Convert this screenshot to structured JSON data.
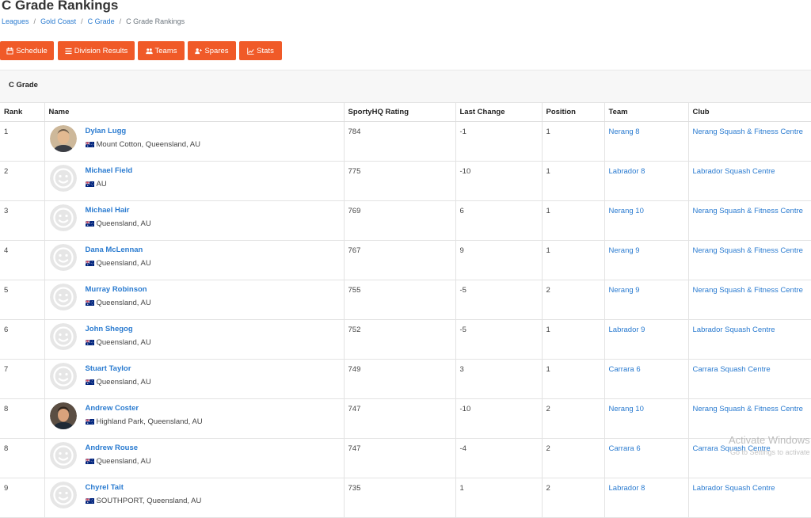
{
  "page": {
    "title": "C Grade Rankings"
  },
  "breadcrumb": {
    "items": [
      {
        "label": "Leagues"
      },
      {
        "label": "Gold Coast"
      },
      {
        "label": "C Grade"
      }
    ],
    "current": "C Grade Rankings",
    "separator": "/"
  },
  "toolbar": {
    "accent_color": "#f05a28",
    "buttons": [
      {
        "label": "Schedule",
        "icon": "calendar-icon"
      },
      {
        "label": "Division Results",
        "icon": "list-icon"
      },
      {
        "label": "Teams",
        "icon": "users-icon"
      },
      {
        "label": "Spares",
        "icon": "user-plus-icon"
      },
      {
        "label": "Stats",
        "icon": "line-chart-icon"
      }
    ]
  },
  "section": {
    "title": "C Grade"
  },
  "table": {
    "columns": [
      "Rank",
      "Name",
      "SportyHQ Rating",
      "Last Change",
      "Position",
      "Team",
      "Club"
    ],
    "rows": [
      {
        "rank": "1",
        "name": "Dylan Lugg",
        "location": "Mount Cotton, Queensland, AU",
        "rating": "784",
        "last_change": "-1",
        "position": "1",
        "team": "Nerang 8",
        "club": "Nerang Squash & Fitness Centre",
        "avatar": "photo"
      },
      {
        "rank": "2",
        "name": "Michael Field",
        "location": "AU",
        "rating": "775",
        "last_change": "-10",
        "position": "1",
        "team": "Labrador 8",
        "club": "Labrador Squash Centre",
        "avatar": "placeholder"
      },
      {
        "rank": "3",
        "name": "Michael Hair",
        "location": "Queensland, AU",
        "rating": "769",
        "last_change": "6",
        "position": "1",
        "team": "Nerang 10",
        "club": "Nerang Squash & Fitness Centre",
        "avatar": "placeholder"
      },
      {
        "rank": "4",
        "name": "Dana McLennan",
        "location": "Queensland, AU",
        "rating": "767",
        "last_change": "9",
        "position": "1",
        "team": "Nerang 9",
        "club": "Nerang Squash & Fitness Centre",
        "avatar": "placeholder"
      },
      {
        "rank": "5",
        "name": "Murray Robinson",
        "location": "Queensland, AU",
        "rating": "755",
        "last_change": "-5",
        "position": "2",
        "team": "Nerang 9",
        "club": "Nerang Squash & Fitness Centre",
        "avatar": "placeholder"
      },
      {
        "rank": "6",
        "name": "John Shegog",
        "location": "Queensland, AU",
        "rating": "752",
        "last_change": "-5",
        "position": "1",
        "team": "Labrador 9",
        "club": "Labrador Squash Centre",
        "avatar": "placeholder"
      },
      {
        "rank": "7",
        "name": "Stuart Taylor",
        "location": "Queensland, AU",
        "rating": "749",
        "last_change": "3",
        "position": "1",
        "team": "Carrara 6",
        "club": "Carrara Squash Centre",
        "avatar": "placeholder"
      },
      {
        "rank": "8",
        "name": "Andrew Coster",
        "location": "Highland Park, Queensland, AU",
        "rating": "747",
        "last_change": "-10",
        "position": "2",
        "team": "Nerang 10",
        "club": "Nerang Squash & Fitness Centre",
        "avatar": "photo"
      },
      {
        "rank": "8",
        "name": "Andrew Rouse",
        "location": "Queensland, AU",
        "rating": "747",
        "last_change": "-4",
        "position": "2",
        "team": "Carrara 6",
        "club": "Carrara Squash Centre",
        "avatar": "placeholder"
      },
      {
        "rank": "9",
        "name": "Chyrel Tait",
        "location": "SOUTHPORT, Queensland, AU",
        "rating": "735",
        "last_change": "1",
        "position": "2",
        "team": "Labrador 8",
        "club": "Labrador Squash Centre",
        "avatar": "placeholder"
      }
    ]
  },
  "watermark": {
    "line1": "Activate Windows",
    "line2": "Go to Settings to activate Windows."
  }
}
